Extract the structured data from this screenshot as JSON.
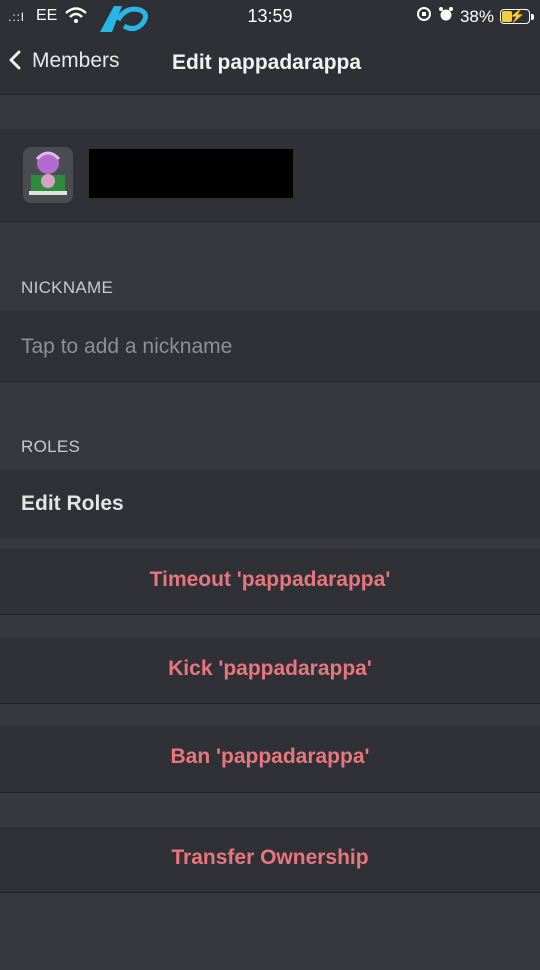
{
  "status_bar": {
    "carrier": "EE",
    "time": "13:59",
    "battery_percent": "38%",
    "battery_level": 0.38
  },
  "nav": {
    "back_label": "Members",
    "title": "Edit pappadarappa"
  },
  "sections": {
    "nickname_label": "NICKNAME",
    "nickname_placeholder": "Tap to add a nickname",
    "nickname_value": "",
    "roles_label": "ROLES",
    "edit_roles": "Edit Roles"
  },
  "actions": {
    "timeout": "Timeout 'pappadarappa'",
    "kick": "Kick 'pappadarappa'",
    "ban": "Ban 'pappadarappa'",
    "transfer": "Transfer Ownership"
  },
  "colors": {
    "background": "#36383e",
    "row_background": "#2f3136",
    "danger_text": "#e8767e"
  }
}
